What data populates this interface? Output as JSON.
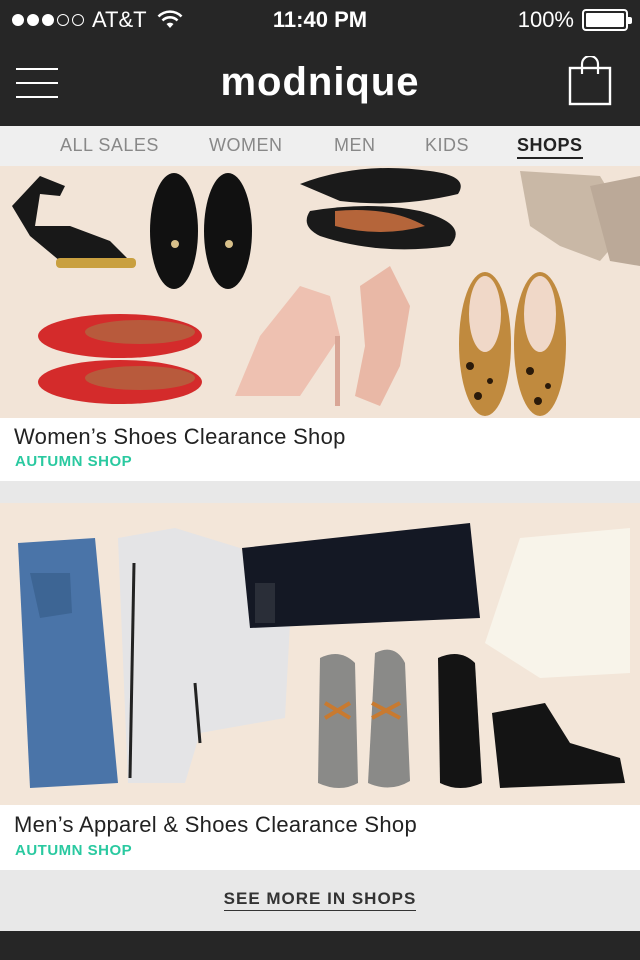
{
  "status_bar": {
    "carrier": "AT&T",
    "signal_bars": 3,
    "time": "11:40 PM",
    "battery": "100%"
  },
  "header": {
    "logo": "modnique",
    "menu_icon": "hamburger-menu-icon",
    "cart_icon": "shopping-bag-icon"
  },
  "tabs": [
    {
      "label": "ALL SALES",
      "active": false
    },
    {
      "label": "WOMEN",
      "active": false
    },
    {
      "label": "MEN",
      "active": false
    },
    {
      "label": "KIDS",
      "active": false
    },
    {
      "label": "SHOPS",
      "active": true
    }
  ],
  "cards": [
    {
      "title": "Women’s Shoes Clearance Shop",
      "tag": "AUTUMN SHOP"
    },
    {
      "title": "Men’s Apparel & Shoes Clearance Shop",
      "tag": "AUTUMN SHOP"
    }
  ],
  "see_more": "SEE MORE IN SHOPS",
  "colors": {
    "bar_background": "#262626",
    "accent_tag": "#2ac9a0",
    "page_background": "#e8e8e8"
  }
}
